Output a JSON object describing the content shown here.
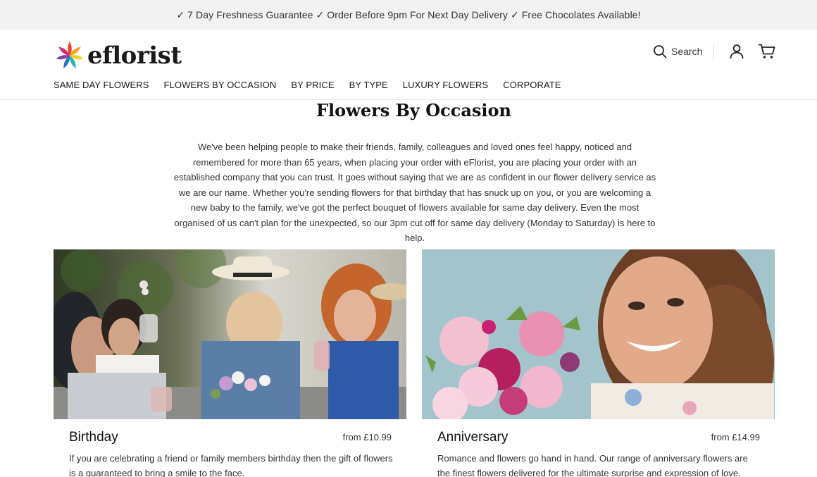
{
  "promo": "✓ 7 Day Freshness Guarantee ✓ Order Before 9pm For Next Day Delivery ✓ Free Chocolates Available!",
  "logo": {
    "text": "eflorist"
  },
  "header": {
    "search_label": "Search"
  },
  "nav": [
    "SAME DAY FLOWERS",
    "FLOWERS BY OCCASION",
    "BY PRICE",
    "BY TYPE",
    "LUXURY FLOWERS",
    "CORPORATE"
  ],
  "page": {
    "title": "Flowers By Occasion",
    "intro": "We've been helping people to make their friends, family, colleagues and loved ones feel happy, noticed and remembered for more than 65 years, when placing your order with eFlorist, you are placing your order with an established company that you can trust. It goes without saying that we are as confident in our flower delivery service as we are our name. Whether you're sending flowers for that birthday that has snuck up on you, or you are welcoming a new baby to the family, we've got the perfect bouquet of flowers available for same day delivery. Even the most organised of us can't plan for the unexpected, so our 3pm cut off for same day delivery (Monday to Saturday) is here to help."
  },
  "cards": [
    {
      "title": "Birthday",
      "price": "from £10.99",
      "desc": "If you are celebrating a friend or family members birthday then the gift of flowers is a guaranteed to bring a smile to the face."
    },
    {
      "title": "Anniversary",
      "price": "from £14.99",
      "desc": "Romance and flowers go hand in hand. Our range of anniversary flowers are the finest flowers delivered for the ultimate surprise and expression of love."
    }
  ],
  "colors": {
    "promo_bg": "#f2f2f2",
    "logo_petals": [
      "#e8452c",
      "#f6a21e",
      "#f4d21f",
      "#2fb5a6",
      "#2b73c2",
      "#8b3fa6",
      "#d6266f"
    ]
  }
}
